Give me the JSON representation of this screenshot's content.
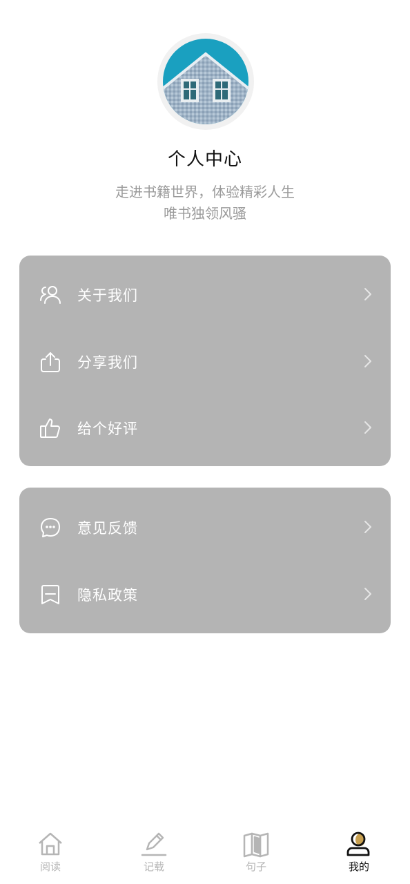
{
  "profile": {
    "title": "个人中心",
    "subtitle_line1": "走进书籍世界，体验精彩人生",
    "subtitle_line2": "唯书独领风骚"
  },
  "menu_group_1": [
    {
      "label": "关于我们",
      "icon": "users-icon"
    },
    {
      "label": "分享我们",
      "icon": "share-icon"
    },
    {
      "label": "给个好评",
      "icon": "thumbs-up-icon"
    }
  ],
  "menu_group_2": [
    {
      "label": "意见反馈",
      "icon": "chat-bubble-icon"
    },
    {
      "label": "隐私政策",
      "icon": "document-icon"
    }
  ],
  "tabbar": {
    "items": [
      {
        "label": "阅读",
        "icon": "home-icon",
        "active": false
      },
      {
        "label": "记载",
        "icon": "pen-icon",
        "active": false
      },
      {
        "label": "句子",
        "icon": "book-icon",
        "active": false
      },
      {
        "label": "我的",
        "icon": "user-icon",
        "active": true
      }
    ]
  },
  "colors": {
    "card_bg": "#b4b4b4",
    "subtitle": "#9a9a9a",
    "tab_inactive": "#b5b5b5",
    "tab_active": "#111111",
    "accent_gold": "#c8a050"
  }
}
